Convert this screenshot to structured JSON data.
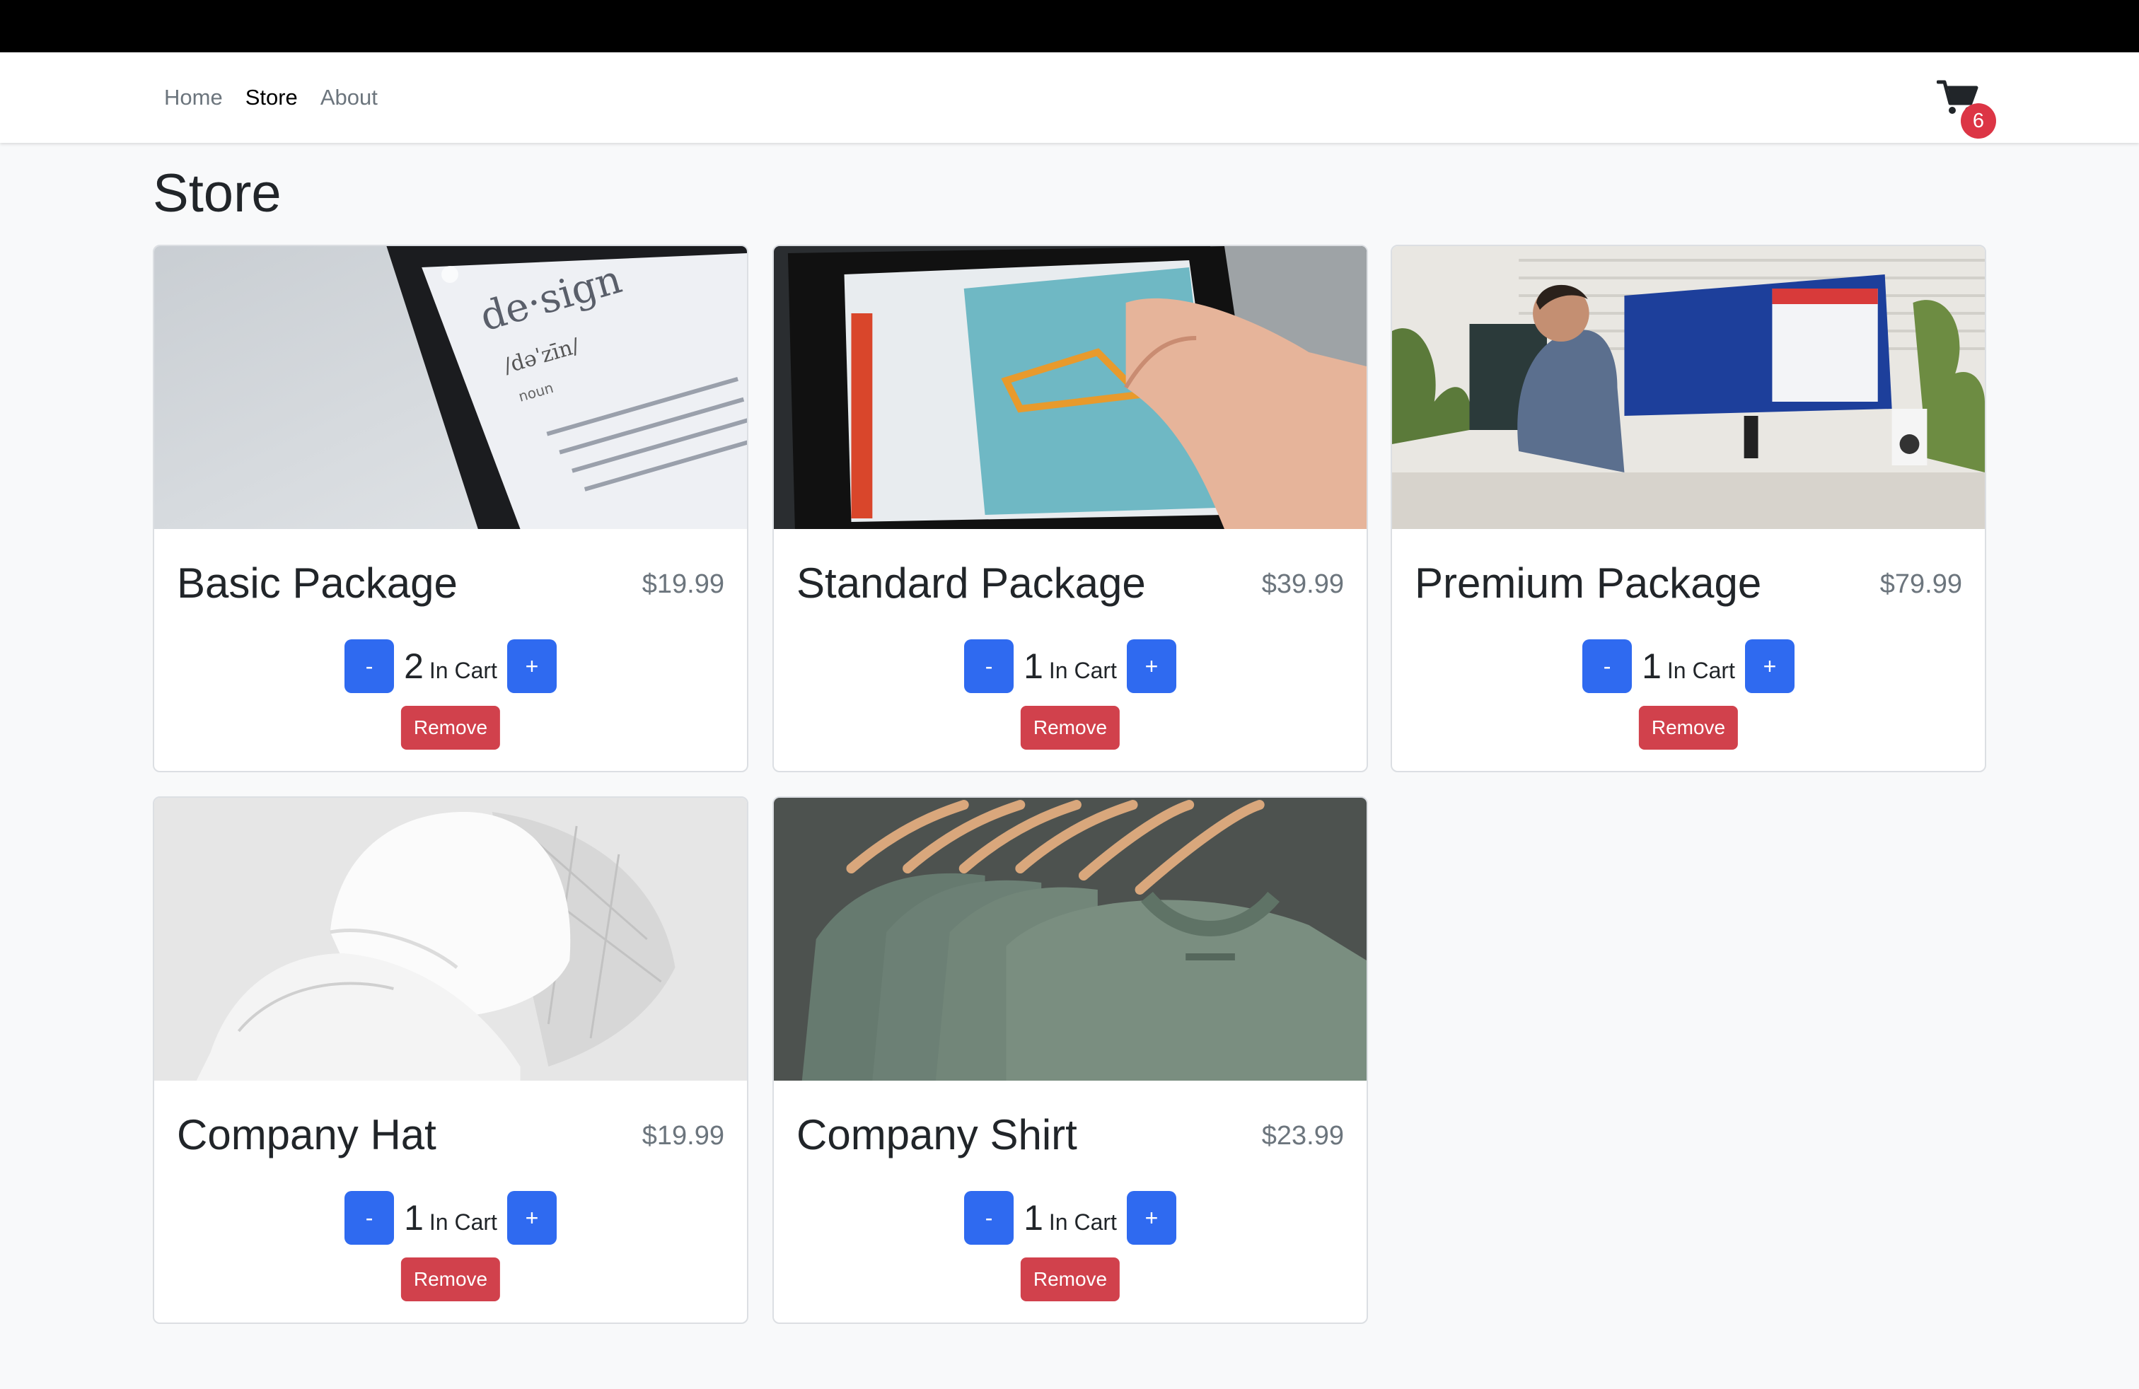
{
  "nav": {
    "links": [
      {
        "label": "Home",
        "active": false
      },
      {
        "label": "Store",
        "active": true
      },
      {
        "label": "About",
        "active": false
      }
    ],
    "cart_count": "6"
  },
  "page": {
    "title": "Store"
  },
  "products": [
    {
      "name": "Basic Package",
      "price": "$19.99",
      "quantity": "2",
      "image": "design-dictionary-phone"
    },
    {
      "name": "Standard Package",
      "price": "$39.99",
      "quantity": "1",
      "image": "hand-touching-tablet-map"
    },
    {
      "name": "Premium Package",
      "price": "$79.99",
      "quantity": "1",
      "image": "man-at-monitors"
    },
    {
      "name": "Company Hat",
      "price": "$19.99",
      "quantity": "1",
      "image": "white-trucker-cap"
    },
    {
      "name": "Company Shirt",
      "price": "$23.99",
      "quantity": "1",
      "image": "green-shirts-on-hangers"
    }
  ],
  "labels": {
    "in_cart": "In Cart",
    "decrement": "-",
    "increment": "+",
    "remove": "Remove"
  },
  "colors": {
    "primary": "#2f6af0",
    "danger": "#d1414c",
    "navbar_bg": "#ffffff",
    "page_bg": "#f8f9fa"
  },
  "image_text": {
    "design_word": "de·sign",
    "design_phonetic": "/dəˈzīn/",
    "design_pos": "noun"
  }
}
